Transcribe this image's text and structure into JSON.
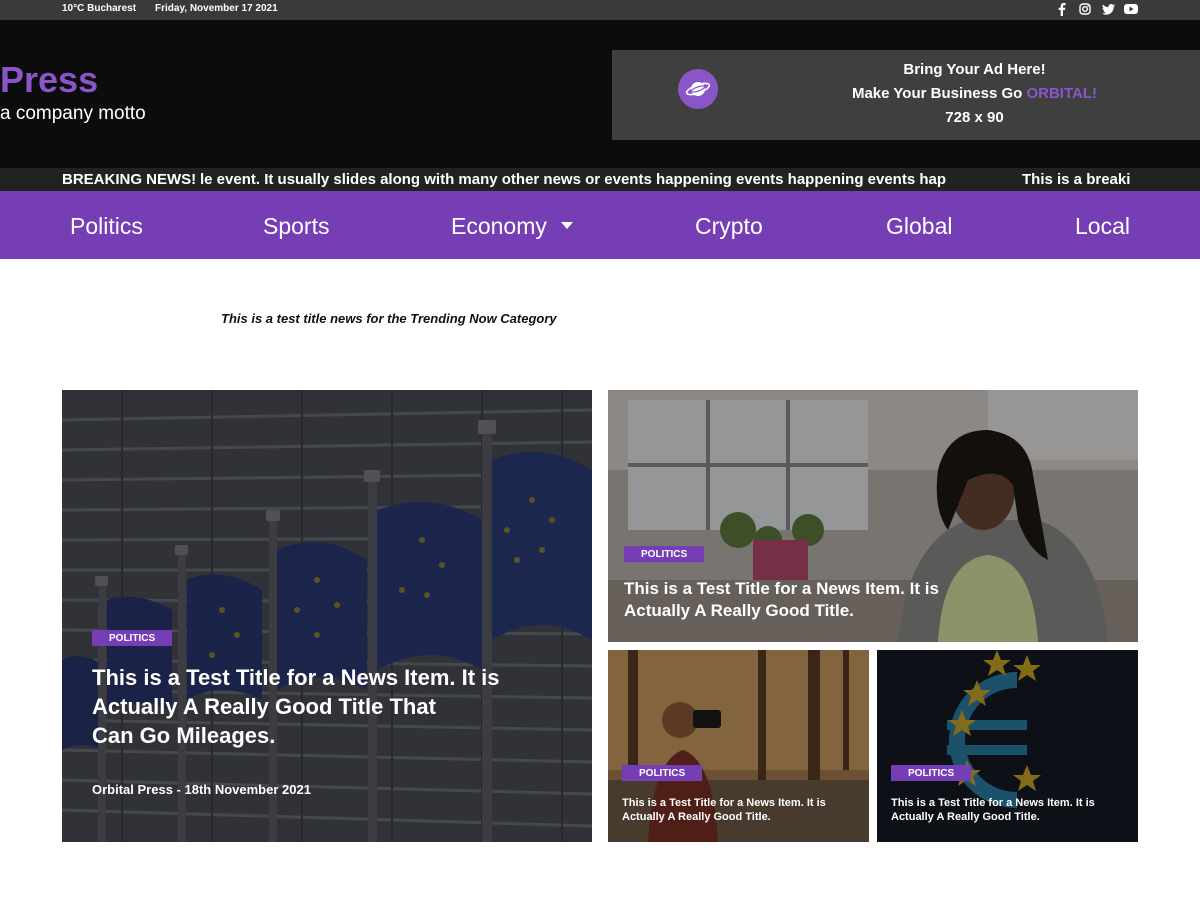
{
  "topbar": {
    "weather": "10°C Bucharest",
    "date": "Friday, November 17 2021",
    "socials": [
      "facebook-icon",
      "instagram-icon",
      "twitter-icon",
      "youtube-icon"
    ]
  },
  "brand": {
    "name": "Press",
    "motto": "a company motto"
  },
  "ad": {
    "line1": "Bring Your Ad Here!",
    "line2_prefix": "Make Your Business Go ",
    "line2_accent": "ORBITAL!",
    "line3": "728 x 90"
  },
  "breaking": {
    "label": "BREAKING NEWS!",
    "ticker1": "le event. It usually slides along with many other news or events happening events happening events hap",
    "ticker2": "This is a breaki"
  },
  "nav": {
    "items": [
      "Politics",
      "Sports",
      "Economy",
      "Crypto",
      "Global",
      "Local"
    ]
  },
  "trending": {
    "title": "This is a test title news for the Trending Now Category"
  },
  "cards": {
    "main": {
      "category": "POLITICS",
      "title_line1": "This is a Test Title for a News Item. It is",
      "title_line2": "Actually A Really Good Title That",
      "title_line3": "Can Go Mileages.",
      "byline": "Orbital Press - 18th November 2021"
    },
    "top_right": {
      "category": "POLITICS",
      "title_line1": "This is a Test Title for a News Item. It is",
      "title_line2": "Actually A Really Good Title."
    },
    "bottom_left": {
      "category": "POLITICS",
      "title_line1": "This is a Test Title for a News Item. It is",
      "title_line2": "Actually A Really Good Title."
    },
    "bottom_right": {
      "category": "POLITICS",
      "title_line1": "This is a Test Title for a News Item. It is",
      "title_line2": "Actually A Really Good Title."
    }
  },
  "colors": {
    "accent": "#763eb5",
    "brand": "#8a55c8",
    "header_bg": "#0c0c0d",
    "topbar_bg": "#3a3a3a"
  }
}
